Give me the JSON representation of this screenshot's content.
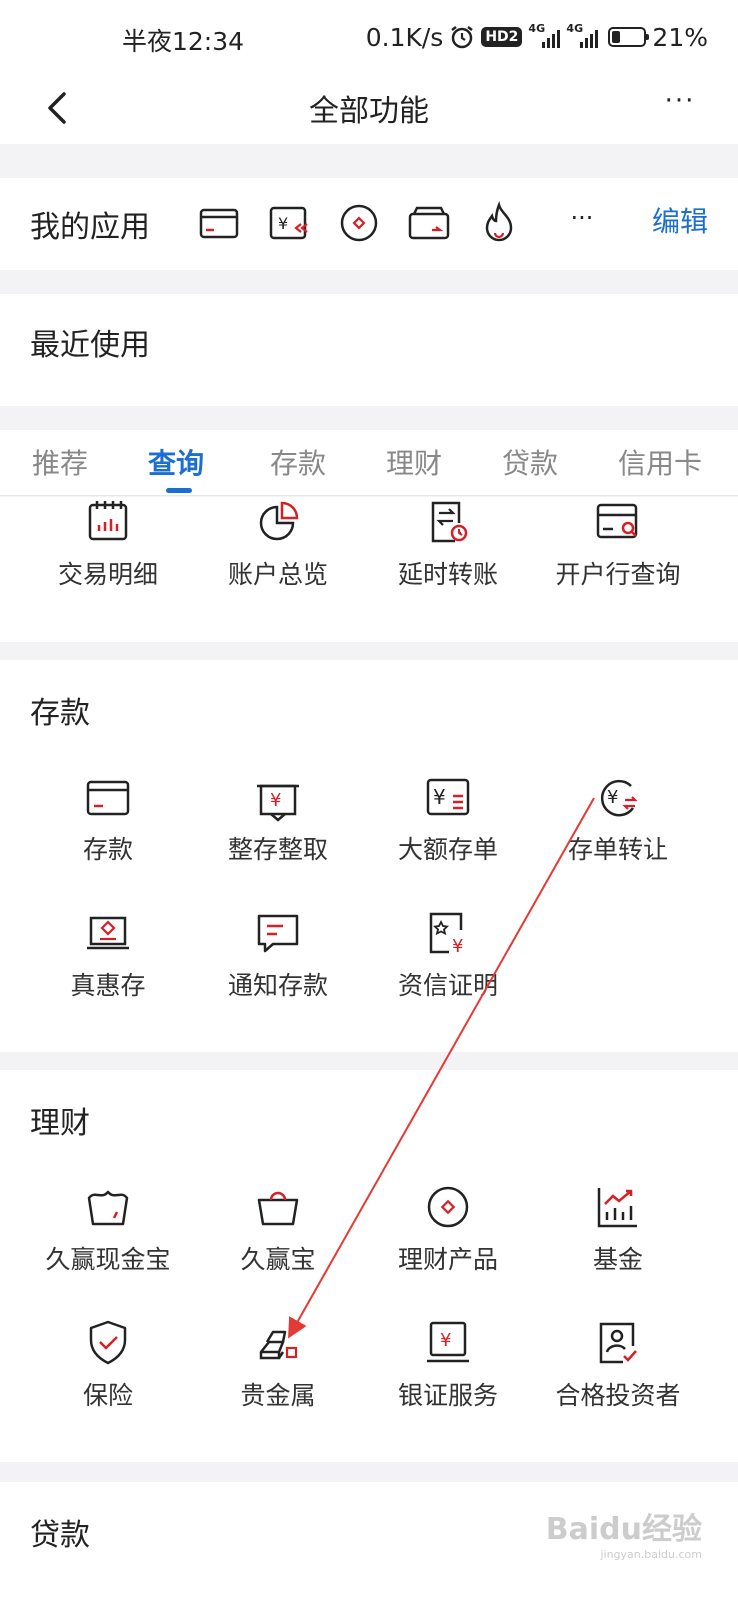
{
  "status_bar": {
    "time": "半夜12:34",
    "speed": "0.1K/s",
    "hd_badge": "HD2",
    "net1": "4G",
    "net2": "4G",
    "battery": "21%"
  },
  "nav": {
    "title": "全部功能",
    "more": "···"
  },
  "my_apps": {
    "label": "我的应用",
    "more": "···",
    "edit": "编辑",
    "icons": [
      "card-icon",
      "yuan-transfer-icon",
      "coin-icon",
      "wallet-icon",
      "flame-icon"
    ]
  },
  "recent": {
    "label": "最近使用"
  },
  "tabs": [
    "推荐",
    "查询",
    "存款",
    "理财",
    "贷款",
    "信用卡"
  ],
  "active_tab": "查询",
  "query_items": [
    {
      "label": "交易明细",
      "icon": "calendar-chart-icon"
    },
    {
      "label": "账户总览",
      "icon": "pie-chart-icon"
    },
    {
      "label": "延时转账",
      "icon": "delayed-transfer-icon"
    },
    {
      "label": "开户行查询",
      "icon": "bank-search-icon"
    }
  ],
  "deposit": {
    "title": "存款",
    "items": [
      {
        "label": "存款",
        "icon": "card-icon"
      },
      {
        "label": "整存整取",
        "icon": "yuan-pocket-icon"
      },
      {
        "label": "大额存单",
        "icon": "yuan-certificate-icon"
      },
      {
        "label": "存单转让",
        "icon": "yuan-circle-transfer-icon"
      },
      {
        "label": "真惠存",
        "icon": "diamond-box-icon"
      },
      {
        "label": "通知存款",
        "icon": "message-icon"
      },
      {
        "label": "资信证明",
        "icon": "credit-certificate-icon"
      }
    ]
  },
  "wealth": {
    "title": "理财",
    "items": [
      {
        "label": "久赢现金宝",
        "icon": "basket-icon"
      },
      {
        "label": "久赢宝",
        "icon": "shopping-basket-icon"
      },
      {
        "label": "理财产品",
        "icon": "coin-icon"
      },
      {
        "label": "基金",
        "icon": "growth-chart-icon"
      },
      {
        "label": "保险",
        "icon": "shield-check-icon"
      },
      {
        "label": "贵金属",
        "icon": "gold-bars-icon"
      },
      {
        "label": "银证服务",
        "icon": "yuan-monitor-icon"
      },
      {
        "label": "合格投资者",
        "icon": "investor-id-icon"
      }
    ]
  },
  "loan": {
    "title": "贷款"
  },
  "watermark": {
    "main": "Baidu经验",
    "sub": "jingyan.baidu.com"
  },
  "colors": {
    "accent": "#1a6fd1",
    "icon_red": "#d61f26",
    "icon_dark": "#222222",
    "arrow": "#e53935"
  }
}
